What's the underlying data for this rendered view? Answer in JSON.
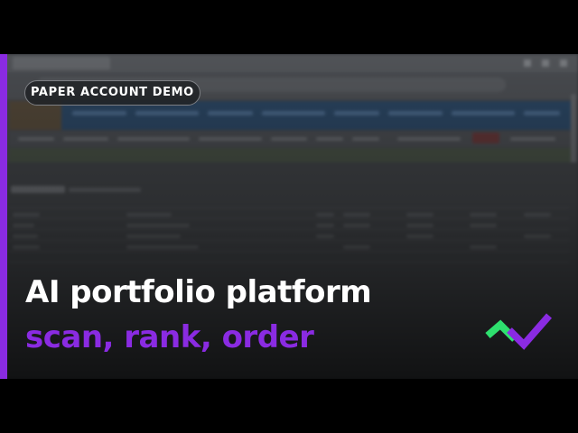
{
  "badge": {
    "label": "PAPER ACCOUNT DEMO"
  },
  "headline": {
    "title": "AI portfolio platform",
    "subtitle": "scan, rank, order"
  },
  "colors": {
    "accent": "#8a2be2",
    "logo_green": "#2ee06e",
    "logo_purple": "#8a2be2",
    "background": "#000000"
  },
  "icons": {
    "logo": "checkmark-trend-logo-icon"
  }
}
